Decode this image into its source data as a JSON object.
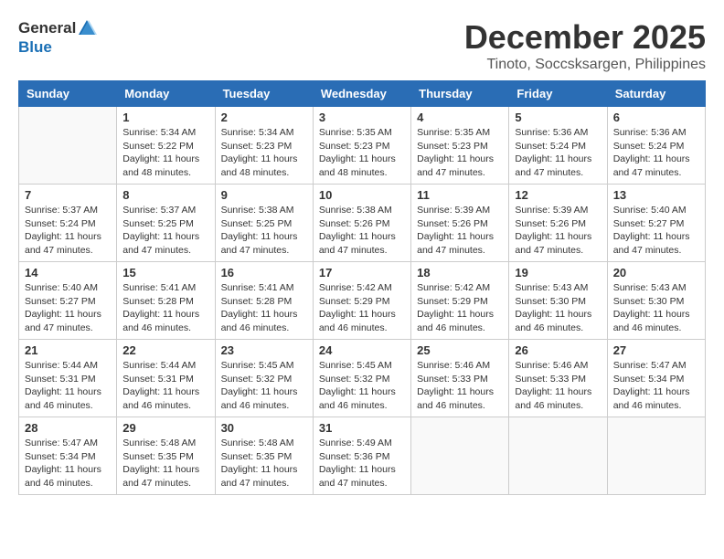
{
  "logo": {
    "general": "General",
    "blue": "Blue"
  },
  "title": "December 2025",
  "location": "Tinoto, Soccsksargen, Philippines",
  "days_header": [
    "Sunday",
    "Monday",
    "Tuesday",
    "Wednesday",
    "Thursday",
    "Friday",
    "Saturday"
  ],
  "weeks": [
    [
      {
        "day": "",
        "info": ""
      },
      {
        "day": "1",
        "info": "Sunrise: 5:34 AM\nSunset: 5:22 PM\nDaylight: 11 hours and 48 minutes."
      },
      {
        "day": "2",
        "info": "Sunrise: 5:34 AM\nSunset: 5:23 PM\nDaylight: 11 hours and 48 minutes."
      },
      {
        "day": "3",
        "info": "Sunrise: 5:35 AM\nSunset: 5:23 PM\nDaylight: 11 hours and 48 minutes."
      },
      {
        "day": "4",
        "info": "Sunrise: 5:35 AM\nSunset: 5:23 PM\nDaylight: 11 hours and 47 minutes."
      },
      {
        "day": "5",
        "info": "Sunrise: 5:36 AM\nSunset: 5:24 PM\nDaylight: 11 hours and 47 minutes."
      },
      {
        "day": "6",
        "info": "Sunrise: 5:36 AM\nSunset: 5:24 PM\nDaylight: 11 hours and 47 minutes."
      }
    ],
    [
      {
        "day": "7",
        "info": "Sunrise: 5:37 AM\nSunset: 5:24 PM\nDaylight: 11 hours and 47 minutes."
      },
      {
        "day": "8",
        "info": "Sunrise: 5:37 AM\nSunset: 5:25 PM\nDaylight: 11 hours and 47 minutes."
      },
      {
        "day": "9",
        "info": "Sunrise: 5:38 AM\nSunset: 5:25 PM\nDaylight: 11 hours and 47 minutes."
      },
      {
        "day": "10",
        "info": "Sunrise: 5:38 AM\nSunset: 5:26 PM\nDaylight: 11 hours and 47 minutes."
      },
      {
        "day": "11",
        "info": "Sunrise: 5:39 AM\nSunset: 5:26 PM\nDaylight: 11 hours and 47 minutes."
      },
      {
        "day": "12",
        "info": "Sunrise: 5:39 AM\nSunset: 5:26 PM\nDaylight: 11 hours and 47 minutes."
      },
      {
        "day": "13",
        "info": "Sunrise: 5:40 AM\nSunset: 5:27 PM\nDaylight: 11 hours and 47 minutes."
      }
    ],
    [
      {
        "day": "14",
        "info": "Sunrise: 5:40 AM\nSunset: 5:27 PM\nDaylight: 11 hours and 47 minutes."
      },
      {
        "day": "15",
        "info": "Sunrise: 5:41 AM\nSunset: 5:28 PM\nDaylight: 11 hours and 46 minutes."
      },
      {
        "day": "16",
        "info": "Sunrise: 5:41 AM\nSunset: 5:28 PM\nDaylight: 11 hours and 46 minutes."
      },
      {
        "day": "17",
        "info": "Sunrise: 5:42 AM\nSunset: 5:29 PM\nDaylight: 11 hours and 46 minutes."
      },
      {
        "day": "18",
        "info": "Sunrise: 5:42 AM\nSunset: 5:29 PM\nDaylight: 11 hours and 46 minutes."
      },
      {
        "day": "19",
        "info": "Sunrise: 5:43 AM\nSunset: 5:30 PM\nDaylight: 11 hours and 46 minutes."
      },
      {
        "day": "20",
        "info": "Sunrise: 5:43 AM\nSunset: 5:30 PM\nDaylight: 11 hours and 46 minutes."
      }
    ],
    [
      {
        "day": "21",
        "info": "Sunrise: 5:44 AM\nSunset: 5:31 PM\nDaylight: 11 hours and 46 minutes."
      },
      {
        "day": "22",
        "info": "Sunrise: 5:44 AM\nSunset: 5:31 PM\nDaylight: 11 hours and 46 minutes."
      },
      {
        "day": "23",
        "info": "Sunrise: 5:45 AM\nSunset: 5:32 PM\nDaylight: 11 hours and 46 minutes."
      },
      {
        "day": "24",
        "info": "Sunrise: 5:45 AM\nSunset: 5:32 PM\nDaylight: 11 hours and 46 minutes."
      },
      {
        "day": "25",
        "info": "Sunrise: 5:46 AM\nSunset: 5:33 PM\nDaylight: 11 hours and 46 minutes."
      },
      {
        "day": "26",
        "info": "Sunrise: 5:46 AM\nSunset: 5:33 PM\nDaylight: 11 hours and 46 minutes."
      },
      {
        "day": "27",
        "info": "Sunrise: 5:47 AM\nSunset: 5:34 PM\nDaylight: 11 hours and 46 minutes."
      }
    ],
    [
      {
        "day": "28",
        "info": "Sunrise: 5:47 AM\nSunset: 5:34 PM\nDaylight: 11 hours and 46 minutes."
      },
      {
        "day": "29",
        "info": "Sunrise: 5:48 AM\nSunset: 5:35 PM\nDaylight: 11 hours and 47 minutes."
      },
      {
        "day": "30",
        "info": "Sunrise: 5:48 AM\nSunset: 5:35 PM\nDaylight: 11 hours and 47 minutes."
      },
      {
        "day": "31",
        "info": "Sunrise: 5:49 AM\nSunset: 5:36 PM\nDaylight: 11 hours and 47 minutes."
      },
      {
        "day": "",
        "info": ""
      },
      {
        "day": "",
        "info": ""
      },
      {
        "day": "",
        "info": ""
      }
    ]
  ]
}
